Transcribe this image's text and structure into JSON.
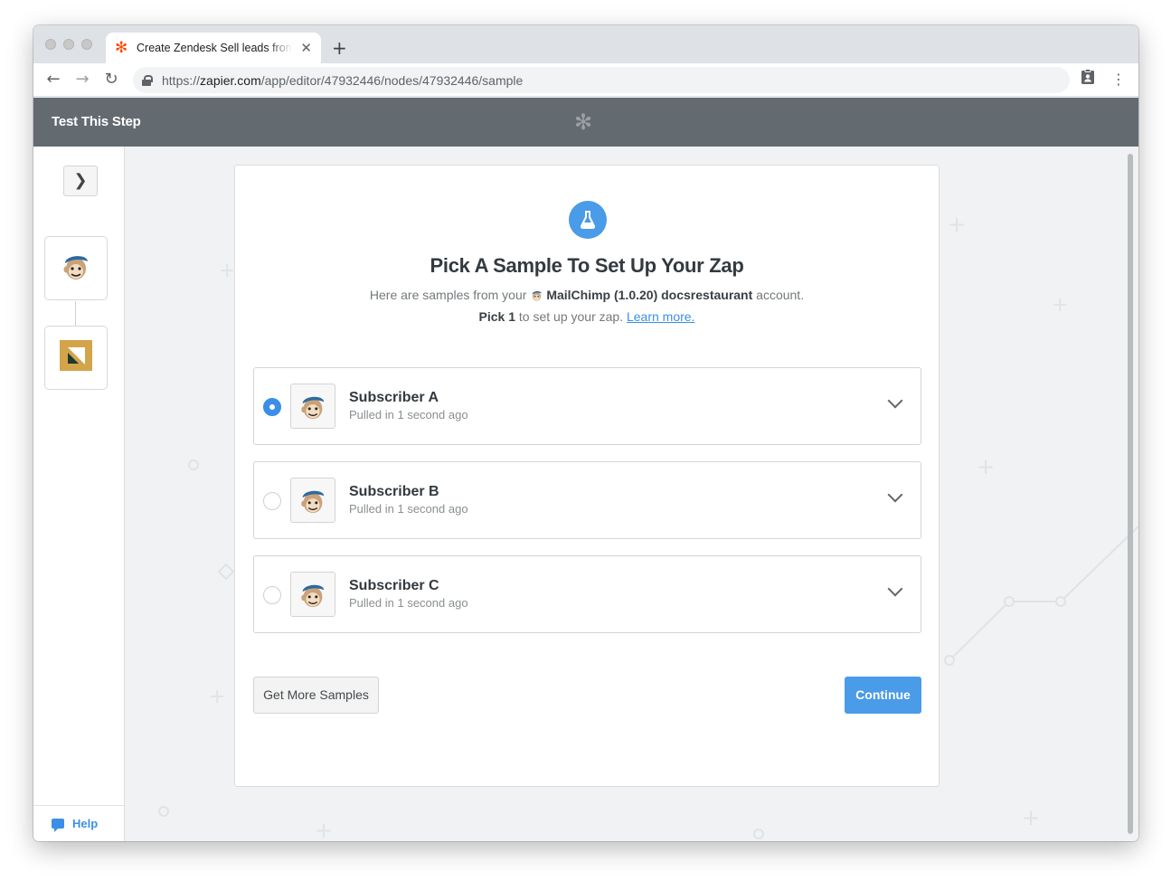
{
  "browser": {
    "tab_title": "Create Zendesk Sell leads from MailChimp",
    "tab_close": "✕",
    "new_tab": "+",
    "url_scheme": "https://",
    "url_host": "zapier.com",
    "url_path": "/app/editor/47932446/nodes/47932446/sample"
  },
  "appbar": {
    "title": "Test This Step",
    "logo": "✻"
  },
  "sidebar": {
    "collapse_glyph": "❯",
    "steps": [
      {
        "app": "MailChimp",
        "icon": "mailchimp-icon"
      },
      {
        "app": "Zendesk Sell",
        "icon": "zendesk-sell-icon"
      }
    ],
    "help_label": "Help"
  },
  "card": {
    "title": "Pick A Sample To Set Up Your Zap",
    "subtitle_prefix": "Here are samples from your",
    "account_name": "MailChimp (1.0.20) docsrestaurant",
    "subtitle_suffix": "account.",
    "pick_bold": "Pick 1",
    "pick_text": "to set up your zap.",
    "learn_more": "Learn more."
  },
  "samples": [
    {
      "name": "Subscriber A",
      "meta": "Pulled in 1 second ago",
      "selected": true
    },
    {
      "name": "Subscriber B",
      "meta": "Pulled in 1 second ago",
      "selected": false
    },
    {
      "name": "Subscriber C",
      "meta": "Pulled in 1 second ago",
      "selected": false
    }
  ],
  "buttons": {
    "get_more": "Get More Samples",
    "continue": "Continue"
  },
  "colors": {
    "accent": "#4a9be8",
    "appbar": "#636b71",
    "zapier_orange": "#ff4a00"
  }
}
